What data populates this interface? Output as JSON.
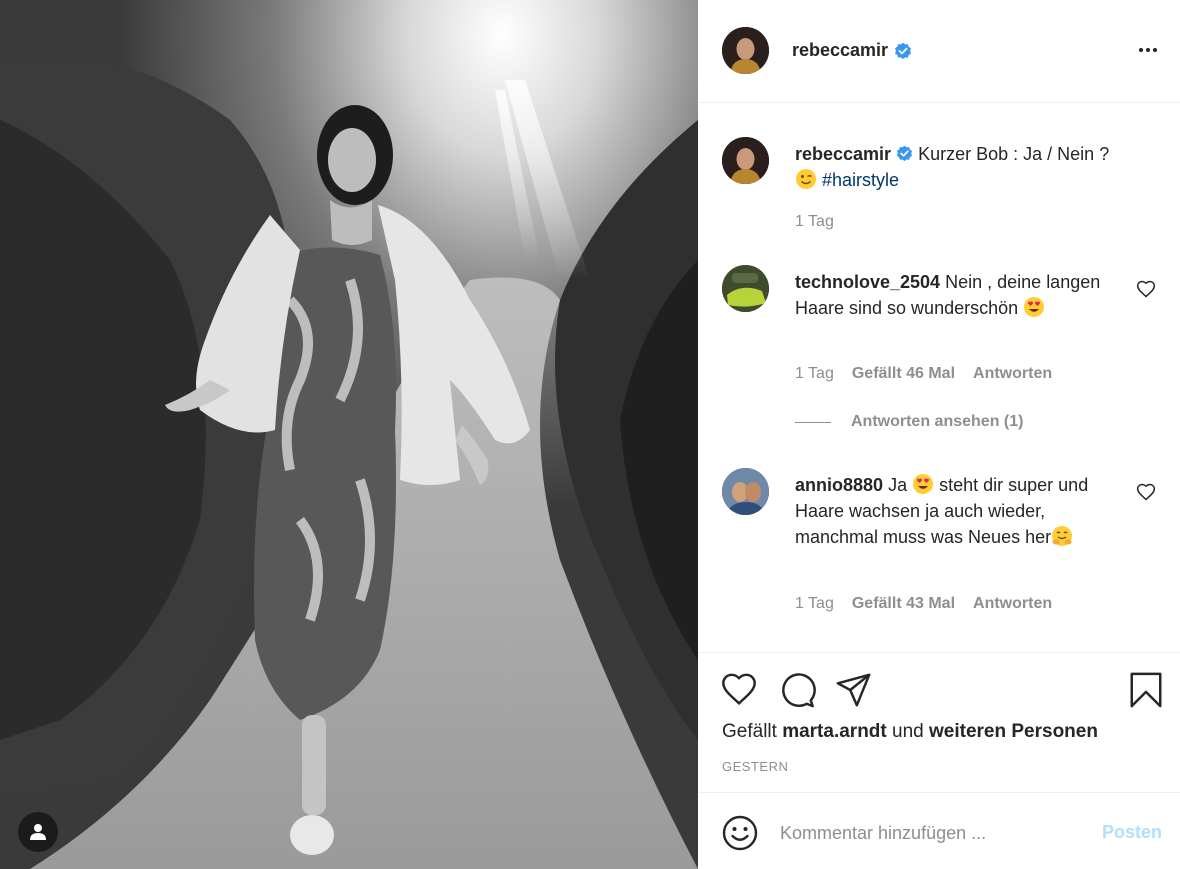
{
  "post": {
    "username": "rebeccamir",
    "verified": true,
    "caption_text": "Kurzer Bob : Ja / Nein ?",
    "caption_hashtag": "#hairstyle",
    "caption_time": "1 Tag"
  },
  "comments": [
    {
      "username": "technolove_2504",
      "text_line1": "Nein , deine",
      "text_rest": "langen Haare sind so wunderschön",
      "time": "1 Tag",
      "likes": "Gefällt 46 Mal",
      "reply": "Antworten",
      "view_replies": "Antworten ansehen (1)"
    },
    {
      "username": "annio8880",
      "text_pre": "Ja",
      "text_post": "steht dir super und Haare wachsen ja auch wieder, manchmal muss was Neues her",
      "time": "1 Tag",
      "likes": "Gefällt 43 Mal",
      "reply": "Antworten"
    }
  ],
  "likes_line": {
    "prefix": "Gefällt",
    "user": "marta.arndt",
    "middle": "und",
    "others": "weiteren Personen"
  },
  "date_label": "GESTERN",
  "comment_input": {
    "placeholder": "Kommentar hinzufügen ...",
    "post_label": "Posten"
  },
  "icons": {
    "header_more": "more-horizontal-icon",
    "like": "heart-icon",
    "comment": "comment-bubble-icon",
    "share": "paper-plane-icon",
    "save": "bookmark-icon",
    "emoji": "smiley-icon",
    "photo_tag": "user-tag-icon"
  },
  "colors": {
    "verified_blue": "#3897f0",
    "hashtag": "#00376b",
    "post_button_disabled": "#b2dffc",
    "muted_text": "#8e8e8e"
  }
}
